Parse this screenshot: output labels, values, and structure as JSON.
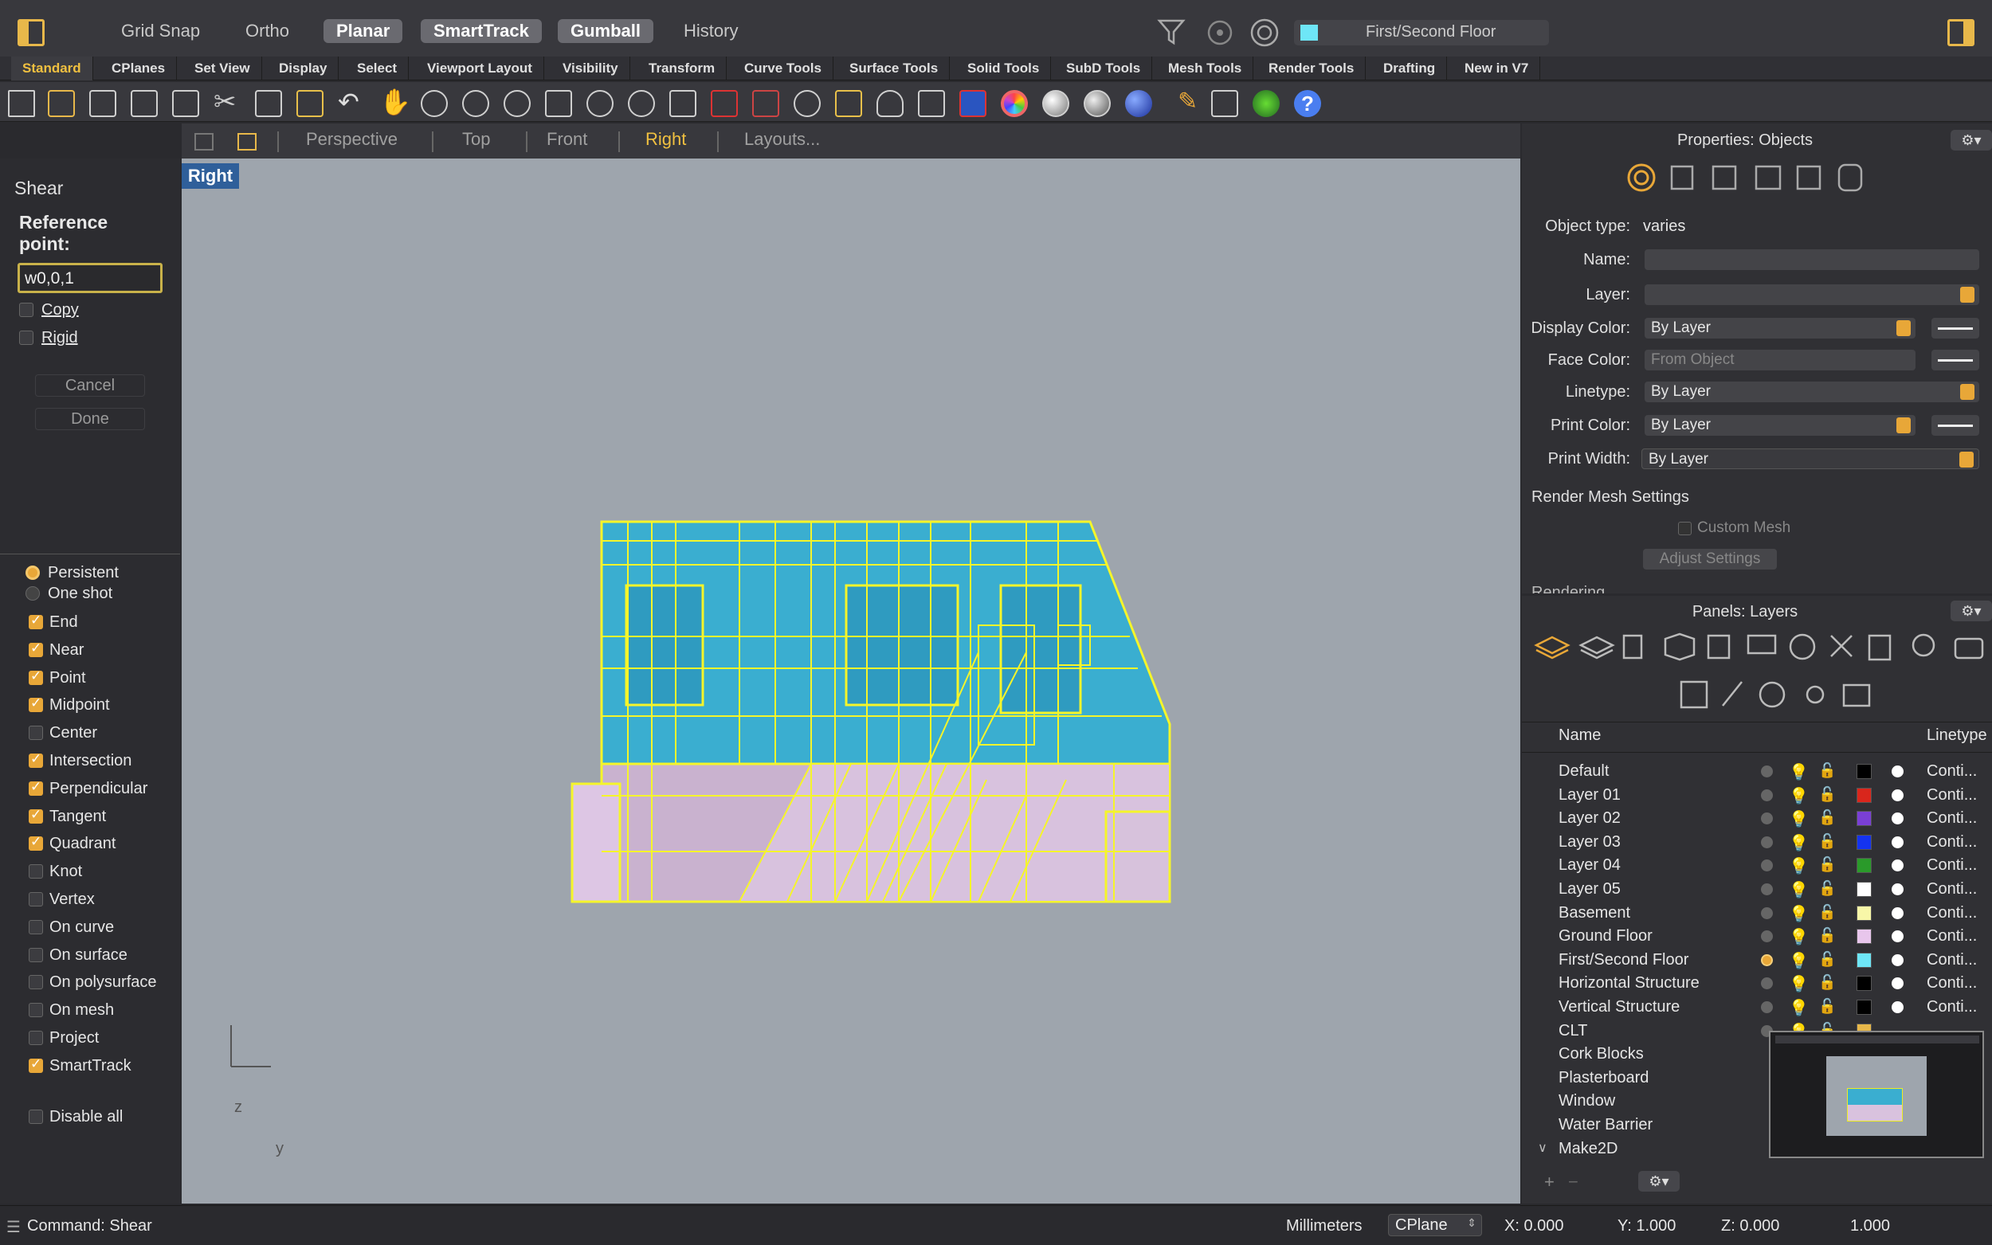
{
  "topbar": {
    "toggles": [
      {
        "label": "Grid Snap",
        "on": false
      },
      {
        "label": "Ortho",
        "on": false
      },
      {
        "label": "Planar",
        "on": true
      },
      {
        "label": "SmartTrack",
        "on": true
      },
      {
        "label": "Gumball",
        "on": true
      },
      {
        "label": "History",
        "on": false
      }
    ],
    "current_layer": "First/Second Floor",
    "current_layer_color": "#6ee6f7"
  },
  "tabs": [
    "Standard",
    "CPlanes",
    "Set View",
    "Display",
    "Select",
    "Viewport Layout",
    "Visibility",
    "Transform",
    "Curve Tools",
    "Surface Tools",
    "Solid Tools",
    "SubD Tools",
    "Mesh Tools",
    "Render Tools",
    "Drafting",
    "New in V7"
  ],
  "active_tab": "Standard",
  "viewtabs": {
    "perspective": "Perspective",
    "top": "Top",
    "front": "Front",
    "right": "Right",
    "layouts": "Layouts..."
  },
  "viewport": {
    "label": "Right",
    "axis_z": "z",
    "axis_y": "y"
  },
  "command": {
    "title": "Shear",
    "prompt": "Reference point:",
    "input_value": "w0,0,1",
    "copy_label": "Copy",
    "rigid_label": "Rigid",
    "cancel_label": "Cancel",
    "done_label": "Done"
  },
  "osnap": {
    "persistent": "Persistent",
    "one_shot": "One shot",
    "items": [
      {
        "label": "End",
        "on": true
      },
      {
        "label": "Near",
        "on": true
      },
      {
        "label": "Point",
        "on": true
      },
      {
        "label": "Midpoint",
        "on": true
      },
      {
        "label": "Center",
        "on": false
      },
      {
        "label": "Intersection",
        "on": true
      },
      {
        "label": "Perpendicular",
        "on": true
      },
      {
        "label": "Tangent",
        "on": true
      },
      {
        "label": "Quadrant",
        "on": true
      },
      {
        "label": "Knot",
        "on": false
      },
      {
        "label": "Vertex",
        "on": false
      },
      {
        "label": "On curve",
        "on": false
      },
      {
        "label": "On surface",
        "on": false
      },
      {
        "label": "On polysurface",
        "on": false
      },
      {
        "label": "On mesh",
        "on": false
      },
      {
        "label": "Project",
        "on": false
      },
      {
        "label": "SmartTrack",
        "on": true
      }
    ],
    "disable_all": "Disable all"
  },
  "properties": {
    "title": "Properties: Objects",
    "object_type_label": "Object type:",
    "object_type_value": "varies",
    "name_label": "Name:",
    "layer_label": "Layer:",
    "display_color_label": "Display Color:",
    "display_color_value": "By Layer",
    "face_color_label": "Face Color:",
    "face_color_value": "From Object",
    "linetype_label": "Linetype:",
    "linetype_value": "By Layer",
    "print_color_label": "Print Color:",
    "print_color_value": "By Layer",
    "print_width_label": "Print Width:",
    "print_width_value": "By Layer",
    "render_mesh_label": "Render Mesh Settings",
    "custom_mesh_label": "Custom Mesh",
    "adjust_settings_label": "Adjust Settings",
    "rendering_label": "Rendering"
  },
  "layers": {
    "title": "Panels: Layers",
    "col_name": "Name",
    "col_linetype": "Linetype",
    "rows": [
      {
        "name": "Default",
        "color": "#000000",
        "current": false,
        "bulb_on": true,
        "linetype": "Conti..."
      },
      {
        "name": "Layer 01",
        "color": "#d9261c",
        "current": false,
        "bulb_on": true,
        "linetype": "Conti..."
      },
      {
        "name": "Layer 02",
        "color": "#7a3fd6",
        "current": false,
        "bulb_on": true,
        "linetype": "Conti..."
      },
      {
        "name": "Layer 03",
        "color": "#1433f0",
        "current": false,
        "bulb_on": true,
        "linetype": "Conti..."
      },
      {
        "name": "Layer 04",
        "color": "#2a9a2a",
        "current": false,
        "bulb_on": true,
        "linetype": "Conti..."
      },
      {
        "name": "Layer 05",
        "color": "#ffffff",
        "current": false,
        "bulb_on": true,
        "linetype": "Conti..."
      },
      {
        "name": "Basement",
        "color": "#f8f7a8",
        "current": false,
        "bulb_on": false,
        "linetype": "Conti..."
      },
      {
        "name": "Ground Floor",
        "color": "#e8c6ec",
        "current": false,
        "bulb_on": true,
        "linetype": "Conti..."
      },
      {
        "name": "First/Second Floor",
        "color": "#6ee6f7",
        "current": true,
        "bulb_on": true,
        "linetype": "Conti..."
      },
      {
        "name": "Horizontal Structure",
        "color": "#000000",
        "current": false,
        "bulb_on": false,
        "linetype": "Conti..."
      },
      {
        "name": "Vertical Structure",
        "color": "#000000",
        "current": false,
        "bulb_on": false,
        "linetype": "Conti..."
      },
      {
        "name": "CLT",
        "color": "#e8b84a",
        "current": false,
        "bulb_on": false,
        "linetype": ""
      },
      {
        "name": "Cork Blocks",
        "color": "",
        "current": false,
        "bulb_on": false,
        "linetype": ""
      },
      {
        "name": "Plasterboard",
        "color": "",
        "current": false,
        "bulb_on": false,
        "linetype": ""
      },
      {
        "name": "Window",
        "color": "",
        "current": false,
        "bulb_on": false,
        "linetype": ""
      },
      {
        "name": "Water Barrier",
        "color": "",
        "current": false,
        "bulb_on": false,
        "linetype": ""
      },
      {
        "name": "Make2D",
        "color": "",
        "current": false,
        "bulb_on": false,
        "linetype": ""
      }
    ]
  },
  "status": {
    "command": "Command: Shear",
    "units": "Millimeters",
    "cplane": "CPlane",
    "x": "X: 0.000",
    "y": "Y: 1.000",
    "z": "Z: 0.000",
    "value": "1.000"
  }
}
